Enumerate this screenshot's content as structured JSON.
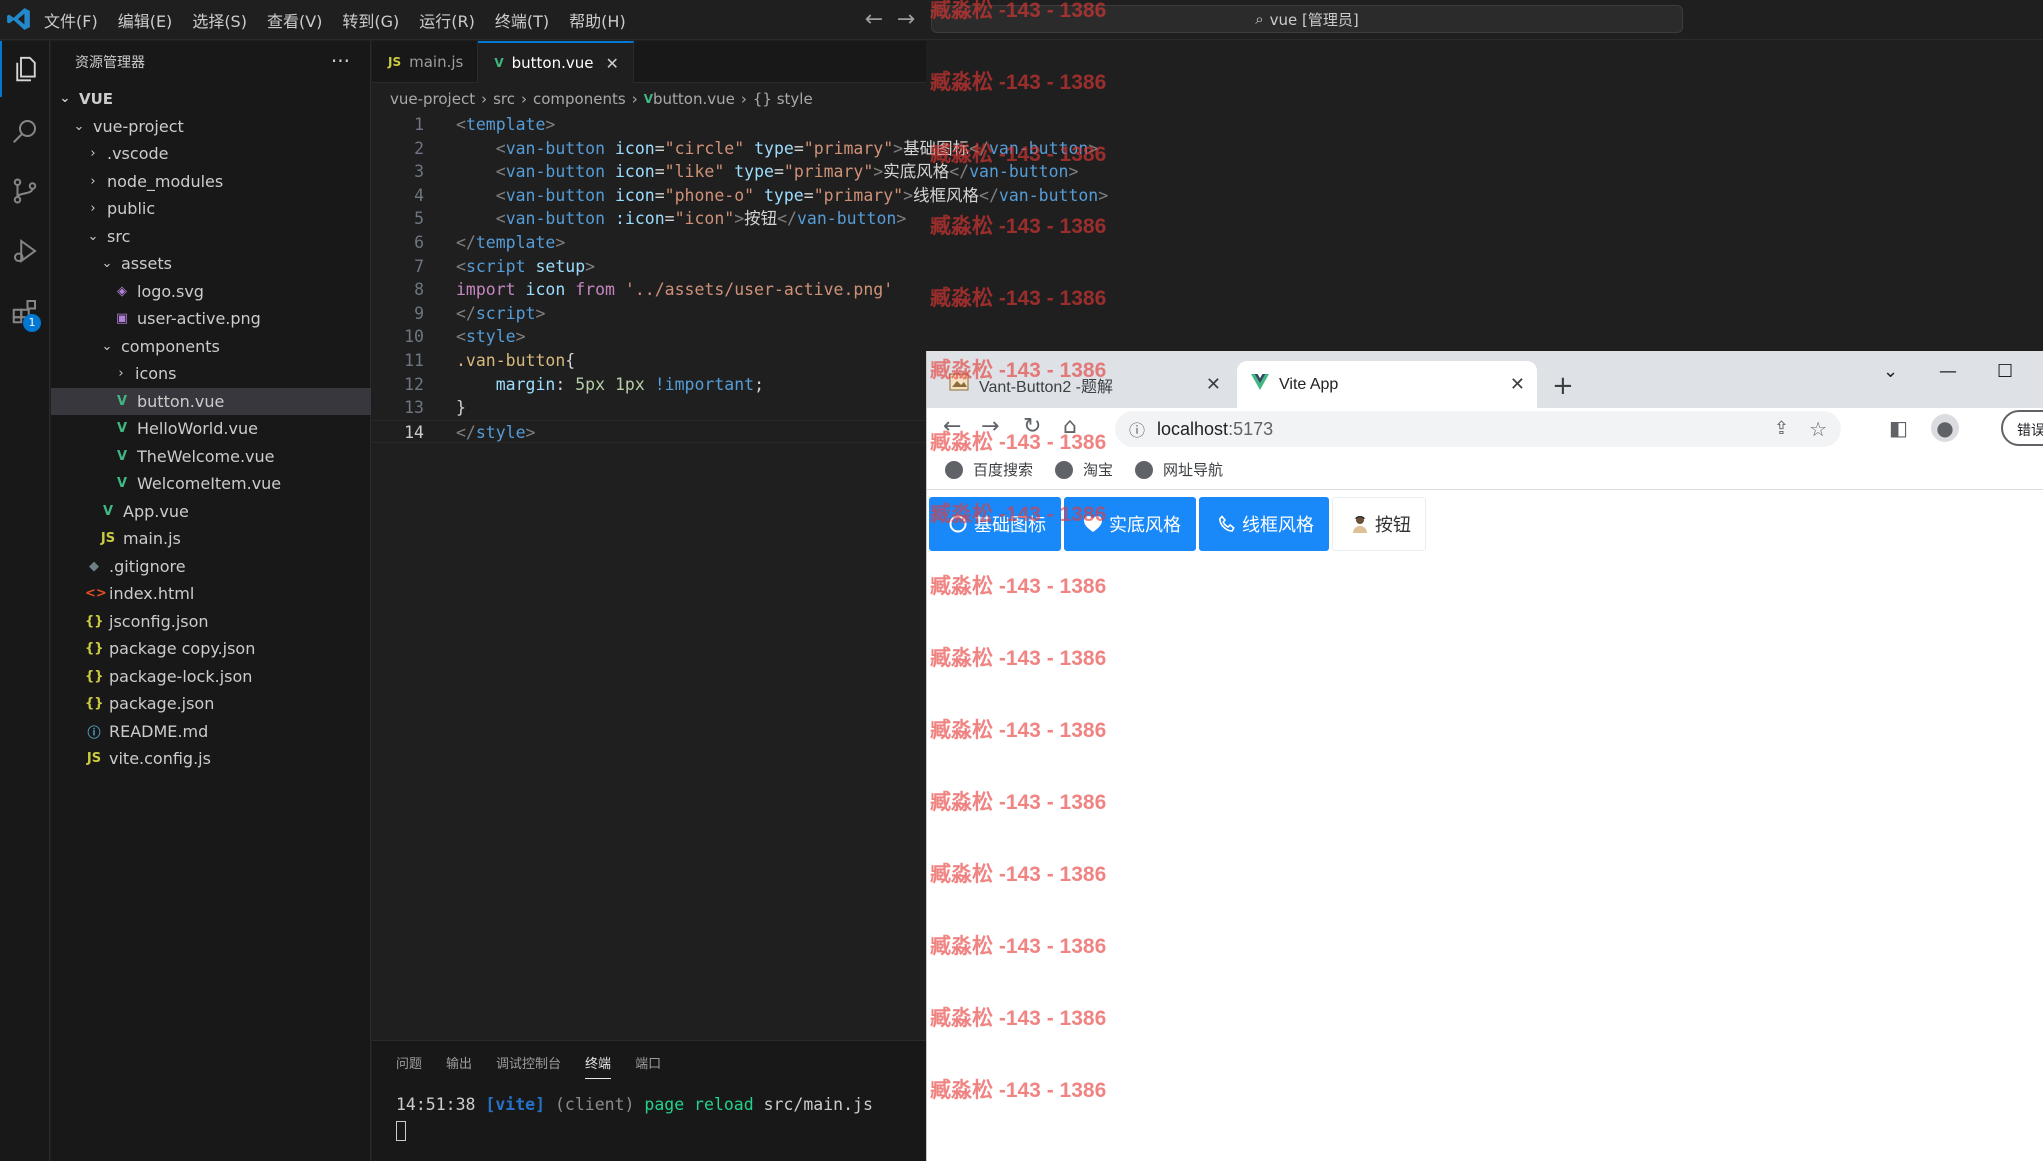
{
  "titlebar": {
    "menu": [
      "文件(F)",
      "编辑(E)",
      "选择(S)",
      "查看(V)",
      "转到(G)",
      "运行(R)",
      "终端(T)",
      "帮助(H)"
    ],
    "command_center": "vue [管理员]"
  },
  "activity": {
    "extensions_badge": "1"
  },
  "sidebar": {
    "title": "资源管理器",
    "root": "VUE",
    "items": [
      {
        "label": "vue-project",
        "depth": 1,
        "kind": "folder-open"
      },
      {
        "label": ".vscode",
        "depth": 2,
        "kind": "folder"
      },
      {
        "label": "node_modules",
        "depth": 2,
        "kind": "folder"
      },
      {
        "label": "public",
        "depth": 2,
        "kind": "folder"
      },
      {
        "label": "src",
        "depth": 2,
        "kind": "folder-open"
      },
      {
        "label": "assets",
        "depth": 3,
        "kind": "folder-open"
      },
      {
        "label": "logo.svg",
        "depth": 4,
        "kind": "svg"
      },
      {
        "label": "user-active.png",
        "depth": 4,
        "kind": "png"
      },
      {
        "label": "components",
        "depth": 3,
        "kind": "folder-open"
      },
      {
        "label": "icons",
        "depth": 4,
        "kind": "folder"
      },
      {
        "label": "button.vue",
        "depth": 4,
        "kind": "vue",
        "selected": true
      },
      {
        "label": "HelloWorld.vue",
        "depth": 4,
        "kind": "vue"
      },
      {
        "label": "TheWelcome.vue",
        "depth": 4,
        "kind": "vue"
      },
      {
        "label": "WelcomeItem.vue",
        "depth": 4,
        "kind": "vue"
      },
      {
        "label": "App.vue",
        "depth": 3,
        "kind": "vue"
      },
      {
        "label": "main.js",
        "depth": 3,
        "kind": "js"
      },
      {
        "label": ".gitignore",
        "depth": 2,
        "kind": "git"
      },
      {
        "label": "index.html",
        "depth": 2,
        "kind": "html"
      },
      {
        "label": "jsconfig.json",
        "depth": 2,
        "kind": "json"
      },
      {
        "label": "package copy.json",
        "depth": 2,
        "kind": "json"
      },
      {
        "label": "package-lock.json",
        "depth": 2,
        "kind": "json"
      },
      {
        "label": "package.json",
        "depth": 2,
        "kind": "json"
      },
      {
        "label": "README.md",
        "depth": 2,
        "kind": "info"
      },
      {
        "label": "vite.config.js",
        "depth": 2,
        "kind": "js"
      }
    ]
  },
  "editor": {
    "tabs": [
      {
        "label": "main.js",
        "icon": "JS",
        "active": false
      },
      {
        "label": "button.vue",
        "icon": "V",
        "active": true
      }
    ],
    "breadcrumb": [
      "vue-project",
      "src",
      "components",
      "button.vue",
      "{} style"
    ],
    "current_line": 14,
    "lines": [
      [
        [
          "tg",
          "<"
        ],
        [
          "tn",
          "template"
        ],
        [
          "tg",
          ">"
        ]
      ],
      [
        [
          "pl",
          "    "
        ],
        [
          "tg",
          "<"
        ],
        [
          "tn",
          "van-button"
        ],
        [
          "pl",
          " "
        ],
        [
          "an",
          "icon"
        ],
        [
          "pl",
          "="
        ],
        [
          "av",
          "\"circle\""
        ],
        [
          "pl",
          " "
        ],
        [
          "an",
          "type"
        ],
        [
          "pl",
          "="
        ],
        [
          "av",
          "\"primary\""
        ],
        [
          "tg",
          ">"
        ],
        [
          "pl",
          "基础图标"
        ],
        [
          "tg",
          "</"
        ],
        [
          "tn",
          "van-button"
        ],
        [
          "tg",
          ">"
        ]
      ],
      [
        [
          "pl",
          "    "
        ],
        [
          "tg",
          "<"
        ],
        [
          "tn",
          "van-button"
        ],
        [
          "pl",
          " "
        ],
        [
          "an",
          "icon"
        ],
        [
          "pl",
          "="
        ],
        [
          "av",
          "\"like\""
        ],
        [
          "pl",
          " "
        ],
        [
          "an",
          "type"
        ],
        [
          "pl",
          "="
        ],
        [
          "av",
          "\"primary\""
        ],
        [
          "tg",
          ">"
        ],
        [
          "pl",
          "实底风格"
        ],
        [
          "tg",
          "</"
        ],
        [
          "tn",
          "van-button"
        ],
        [
          "tg",
          ">"
        ]
      ],
      [
        [
          "pl",
          "    "
        ],
        [
          "tg",
          "<"
        ],
        [
          "tn",
          "van-button"
        ],
        [
          "pl",
          " "
        ],
        [
          "an",
          "icon"
        ],
        [
          "pl",
          "="
        ],
        [
          "av",
          "\"phone-o\""
        ],
        [
          "pl",
          " "
        ],
        [
          "an",
          "type"
        ],
        [
          "pl",
          "="
        ],
        [
          "av",
          "\"primary\""
        ],
        [
          "tg",
          ">"
        ],
        [
          "pl",
          "线框风格"
        ],
        [
          "tg",
          "</"
        ],
        [
          "tn",
          "van-button"
        ],
        [
          "tg",
          ">"
        ]
      ],
      [
        [
          "pl",
          "    "
        ],
        [
          "tg",
          "<"
        ],
        [
          "tn",
          "van-button"
        ],
        [
          "pl",
          " "
        ],
        [
          "an",
          ":icon"
        ],
        [
          "pl",
          "="
        ],
        [
          "av",
          "\"icon\""
        ],
        [
          "tg",
          ">"
        ],
        [
          "pl",
          "按钮"
        ],
        [
          "tg",
          "</"
        ],
        [
          "tn",
          "van-button"
        ],
        [
          "tg",
          ">"
        ]
      ],
      [
        [
          "tg",
          "</"
        ],
        [
          "tn",
          "template"
        ],
        [
          "tg",
          ">"
        ]
      ],
      [
        [
          "tg",
          "<"
        ],
        [
          "tn",
          "script"
        ],
        [
          "pl",
          " "
        ],
        [
          "an",
          "setup"
        ],
        [
          "tg",
          ">"
        ]
      ],
      [
        [
          "kw",
          "import"
        ],
        [
          "pl",
          " "
        ],
        [
          "an",
          "icon"
        ],
        [
          "pl",
          " "
        ],
        [
          "kw",
          "from"
        ],
        [
          "pl",
          " "
        ],
        [
          "av",
          "'../assets/user-active.png'"
        ]
      ],
      [
        [
          "tg",
          "</"
        ],
        [
          "tn",
          "script"
        ],
        [
          "tg",
          ">"
        ]
      ],
      [
        [
          "tg",
          "<"
        ],
        [
          "tn",
          "style"
        ],
        [
          "tg",
          ">"
        ]
      ],
      [
        [
          "sel-c",
          ".van-button"
        ],
        [
          "pl",
          "{"
        ]
      ],
      [
        [
          "pl",
          "    "
        ],
        [
          "an",
          "margin"
        ],
        [
          "pl",
          ": "
        ],
        [
          "num-c",
          "5px"
        ],
        [
          "pl",
          " "
        ],
        [
          "num-c",
          "1px"
        ],
        [
          "pl",
          " "
        ],
        [
          "imp",
          "!important"
        ],
        [
          "pl",
          ";"
        ]
      ],
      [
        [
          "pl",
          "}"
        ]
      ],
      [
        [
          "tg",
          "</"
        ],
        [
          "tn",
          "style"
        ],
        [
          "tg",
          ">"
        ]
      ]
    ]
  },
  "panel": {
    "tabs": [
      "问题",
      "输出",
      "调试控制台",
      "终端",
      "端口"
    ],
    "active_tab": "终端",
    "terminal": {
      "time": "14:51:38",
      "tag": "[vite]",
      "client": "(client)",
      "msg": "page reload",
      "path": "src/main.js"
    }
  },
  "browser": {
    "tabs": [
      {
        "title": "Vant-Button2 -题解",
        "active": false
      },
      {
        "title": "Vite App",
        "active": true
      }
    ],
    "url_host": "localhost",
    "url_port": ":5173",
    "profile_button": "错误",
    "bookmarks": [
      "百度搜索",
      "淘宝",
      "网址导航"
    ],
    "buttons": [
      {
        "label": "基础图标",
        "icon": "circle-icon",
        "style": "primary"
      },
      {
        "label": "实底风格",
        "icon": "like-icon",
        "style": "primary"
      },
      {
        "label": "线框风格",
        "icon": "phone-o-icon",
        "style": "primary"
      },
      {
        "label": "按钮",
        "icon": "user-image-icon",
        "style": "default"
      }
    ]
  },
  "watermark": {
    "text": "臧淼松 -143 - 1386",
    "count": 16
  },
  "colors": {
    "accent": "#0078d4",
    "vant_primary": "#1989fa",
    "watermark": "#e53935",
    "vue_green": "#41b883"
  }
}
